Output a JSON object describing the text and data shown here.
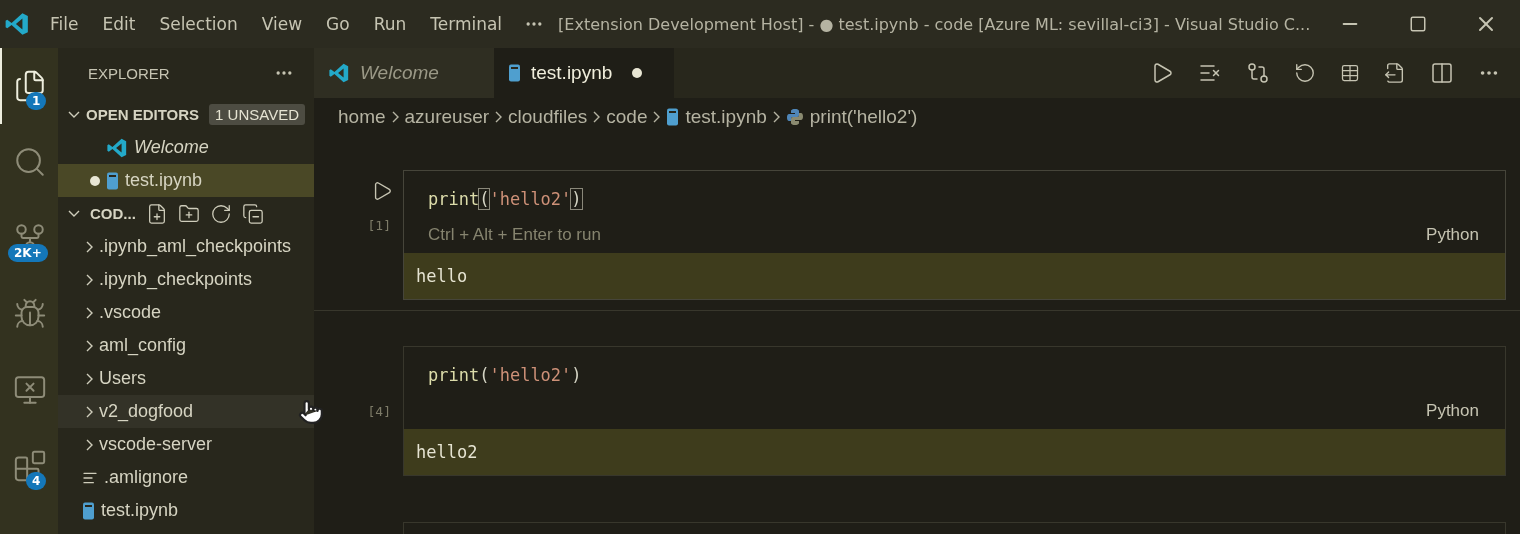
{
  "title_bar": {
    "menu": [
      "File",
      "Edit",
      "Selection",
      "View",
      "Go",
      "Run",
      "Terminal"
    ],
    "title": "[Extension Development Host] - ● test.ipynb - code [Azure ML: sevillal-ci3] - Visual Studio C..."
  },
  "activity_bar": [
    {
      "kind": "explorer",
      "badge": "1",
      "selected": true
    },
    {
      "kind": "search",
      "selected": false
    },
    {
      "kind": "source-control",
      "badge": "2K+",
      "selected": false
    },
    {
      "kind": "debug",
      "selected": false
    },
    {
      "kind": "remote",
      "selected": false
    },
    {
      "kind": "extensions",
      "badge": "4",
      "selected": false
    }
  ],
  "sidebar": {
    "title": "EXPLORER",
    "open_editors": {
      "label": "OPEN EDITORS",
      "badge": "1 UNSAVED",
      "expanded": true,
      "items": [
        {
          "name": "Welcome",
          "kind": "welcome",
          "preview": true,
          "dirty": false,
          "selected": false
        },
        {
          "name": "test.ipynb",
          "kind": "notebook",
          "preview": false,
          "dirty": true,
          "selected": true
        }
      ]
    },
    "folder": {
      "label": "COD...",
      "expanded": true,
      "items": [
        {
          "name": ".ipynb_aml_checkpoints",
          "kind": "folder",
          "hovered": false
        },
        {
          "name": ".ipynb_checkpoints",
          "kind": "folder",
          "hovered": false
        },
        {
          "name": ".vscode",
          "kind": "folder",
          "hovered": false
        },
        {
          "name": "aml_config",
          "kind": "folder",
          "hovered": false
        },
        {
          "name": "Users",
          "kind": "folder",
          "hovered": false
        },
        {
          "name": "v2_dogfood",
          "kind": "folder",
          "hovered": true
        },
        {
          "name": "vscode-server",
          "kind": "folder",
          "hovered": false
        },
        {
          "name": ".amlignore",
          "kind": "text",
          "hovered": false
        },
        {
          "name": "test.ipynb",
          "kind": "notebook",
          "hovered": false
        }
      ]
    }
  },
  "tabs": [
    {
      "label": "Welcome",
      "kind": "welcome",
      "preview": true,
      "dirty": false,
      "selected": false
    },
    {
      "label": "test.ipynb",
      "kind": "notebook",
      "preview": false,
      "dirty": true,
      "selected": true
    }
  ],
  "breadcrumb": [
    {
      "label": "home",
      "kind": "folder"
    },
    {
      "label": "azureuser",
      "kind": "folder"
    },
    {
      "label": "cloudfiles",
      "kind": "folder"
    },
    {
      "label": "code",
      "kind": "folder"
    },
    {
      "label": "test.ipynb",
      "kind": "notebook"
    },
    {
      "label": "print('hello2')",
      "kind": "python"
    }
  ],
  "cells": [
    {
      "execution_count": "[1]",
      "focused": true,
      "tokens": [
        {
          "text": "print",
          "color": "#dcdcaa",
          "matched": false
        },
        {
          "text": "(",
          "color": "#d4d4c4",
          "matched": true
        },
        {
          "text": "'hello2'",
          "color": "#ce9178",
          "matched": false
        },
        {
          "text": ")",
          "color": "#d4d4c4",
          "matched": true
        }
      ],
      "hint": "Ctrl + Alt + Enter to run",
      "language": "Python",
      "output": "hello"
    },
    {
      "execution_count": "[4]",
      "focused": false,
      "tokens": [
        {
          "text": "print",
          "color": "#dcdcaa",
          "matched": false
        },
        {
          "text": "(",
          "color": "#d4d4c4",
          "matched": false
        },
        {
          "text": "'hello2'",
          "color": "#ce9178",
          "matched": false
        },
        {
          "text": ")",
          "color": "#d4d4c4",
          "matched": false
        }
      ],
      "language": "Python",
      "output": "hello2"
    }
  ]
}
